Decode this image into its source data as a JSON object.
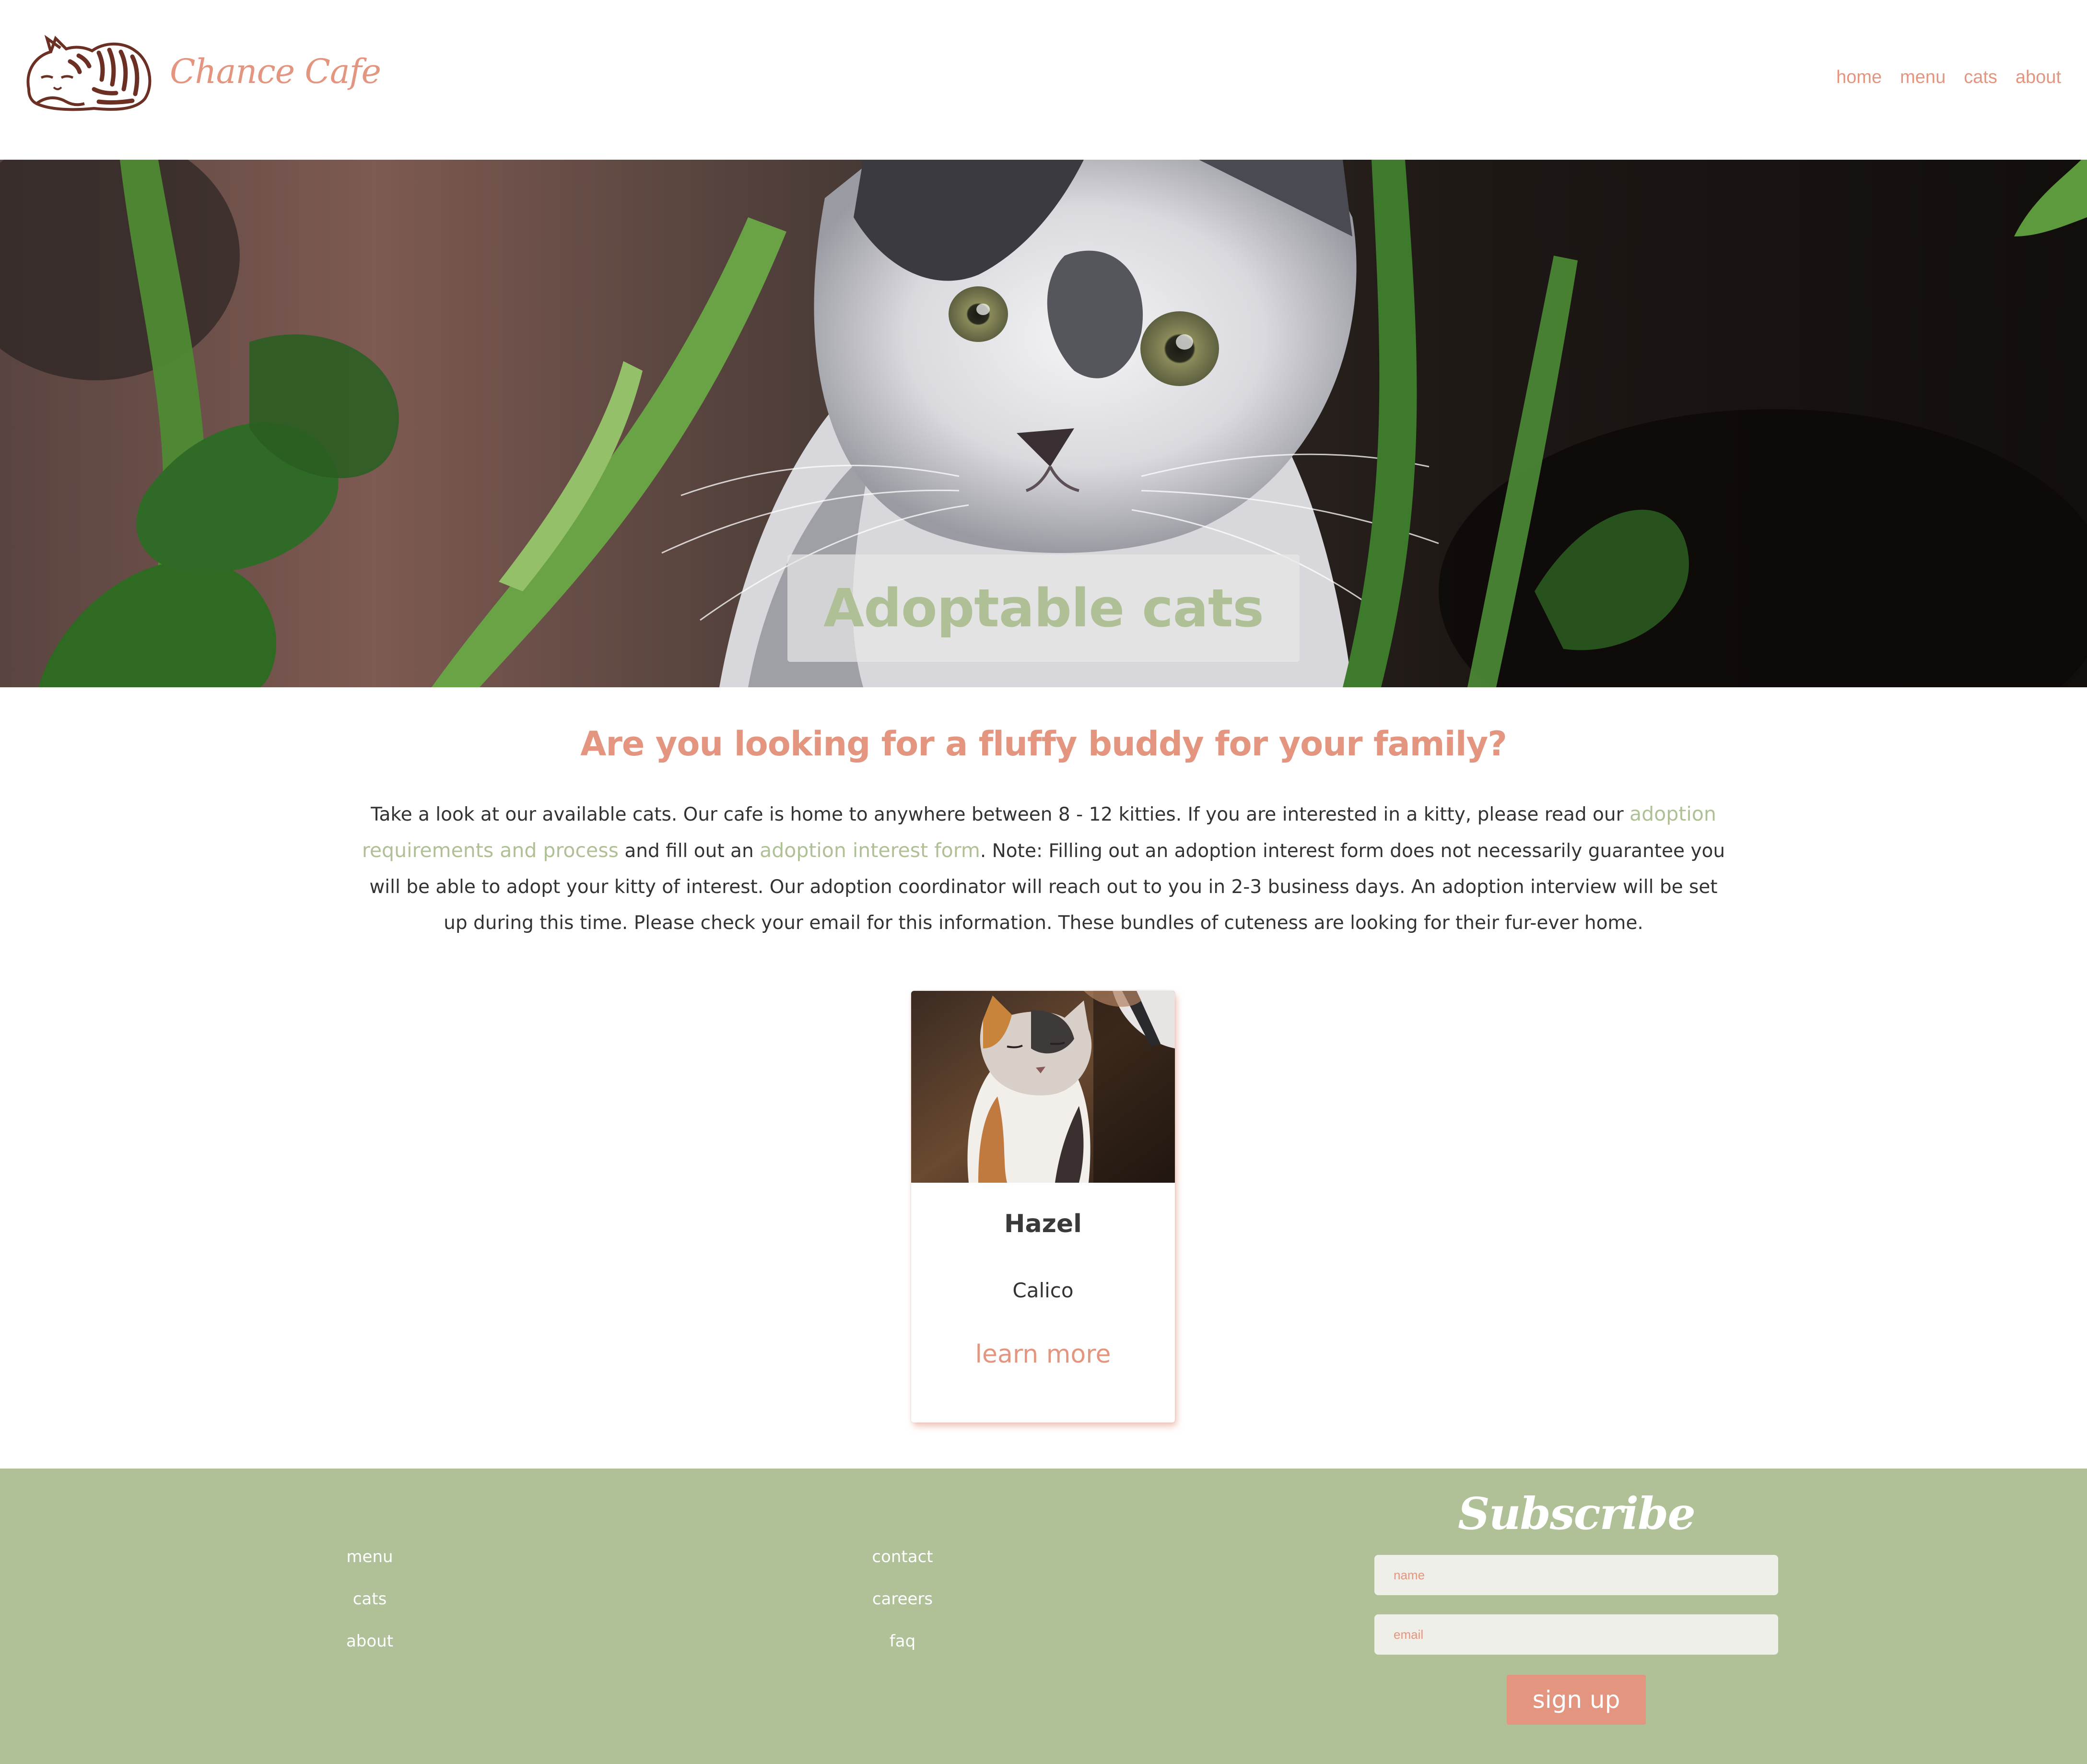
{
  "header": {
    "logo_text": "Chance Cafe",
    "nav": [
      "home",
      "menu",
      "cats",
      "about"
    ]
  },
  "hero": {
    "title": "Adoptable cats"
  },
  "intro": {
    "heading": "Are you looking for a fluffy buddy for your family?",
    "text_1": "Take a look at our available cats. Our cafe is home to anywhere between 8 - 12 kitties. If you are interested in a kitty, please read our ",
    "link_requirements": "adoption requirements and process",
    "text_2": " and fill out an ",
    "link_form": "adoption interest form",
    "text_3": ". Note: Filling out an adoption interest form does not necessarily guarantee you will be able to adopt your kitty of interest. Our adoption coordinator will reach out to you in 2-3 business days. An adoption interview will be set up during this time. Please check your email for this information. These bundles of cuteness are looking for their fur-ever home."
  },
  "cats": [
    {
      "name": "Hazel",
      "breed": "Calico",
      "link": "learn more"
    }
  ],
  "footer": {
    "col1": [
      "menu",
      "cats",
      "about"
    ],
    "col2": [
      "contact",
      "careers",
      "faq"
    ],
    "subscribe": {
      "title": "Subscribe",
      "name_placeholder": "name",
      "email_placeholder": "email",
      "button": "sign up"
    }
  },
  "colors": {
    "accent_salmon": "#e4957f",
    "accent_sage": "#afc096",
    "footer_bg": "#b0c097",
    "text_dark": "#333333"
  },
  "icons": [
    "sleeping-cat-logo-icon"
  ]
}
